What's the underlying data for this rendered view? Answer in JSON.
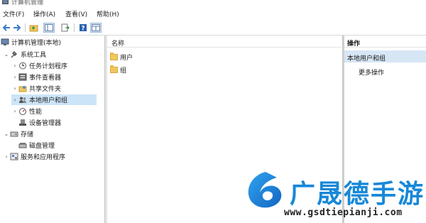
{
  "window": {
    "title": "计算机管理"
  },
  "menu": [
    "文件(F)",
    "操作(A)",
    "查看(V)",
    "帮助(H)"
  ],
  "toolbar": [
    "back-icon",
    "forward-icon",
    "up-folder-icon",
    "show-hide-tree-icon",
    "export-icon",
    "help-icon",
    "properties-icon"
  ],
  "tree": [
    {
      "label": "计算机管理(本地)",
      "icon": "computer-management-icon"
    },
    {
      "label": "系统工具",
      "icon": "system-tools-icon"
    },
    {
      "label": "任务计划程序",
      "icon": "task-scheduler-icon"
    },
    {
      "label": "事件查看器",
      "icon": "event-viewer-icon"
    },
    {
      "label": "共享文件夹",
      "icon": "shared-folders-icon"
    },
    {
      "label": "本地用户和组",
      "icon": "local-users-groups-icon"
    },
    {
      "label": "性能",
      "icon": "performance-icon"
    },
    {
      "label": "设备管理器",
      "icon": "device-manager-icon"
    },
    {
      "label": "存储",
      "icon": "storage-icon"
    },
    {
      "label": "磁盘管理",
      "icon": "disk-management-icon"
    },
    {
      "label": "服务和应用程序",
      "icon": "services-apps-icon"
    }
  ],
  "center": {
    "column_header": "名称",
    "items": [
      "用户",
      "组"
    ]
  },
  "actions": {
    "header": "操作",
    "group": "本地用户和组",
    "items": [
      "更多操作"
    ]
  },
  "watermark": {
    "text": "广晟德手游",
    "url": "www.gsdtiepianji.com"
  },
  "colors": {
    "selection": "#cce4f7",
    "watermark_blue": "#1788d8"
  }
}
